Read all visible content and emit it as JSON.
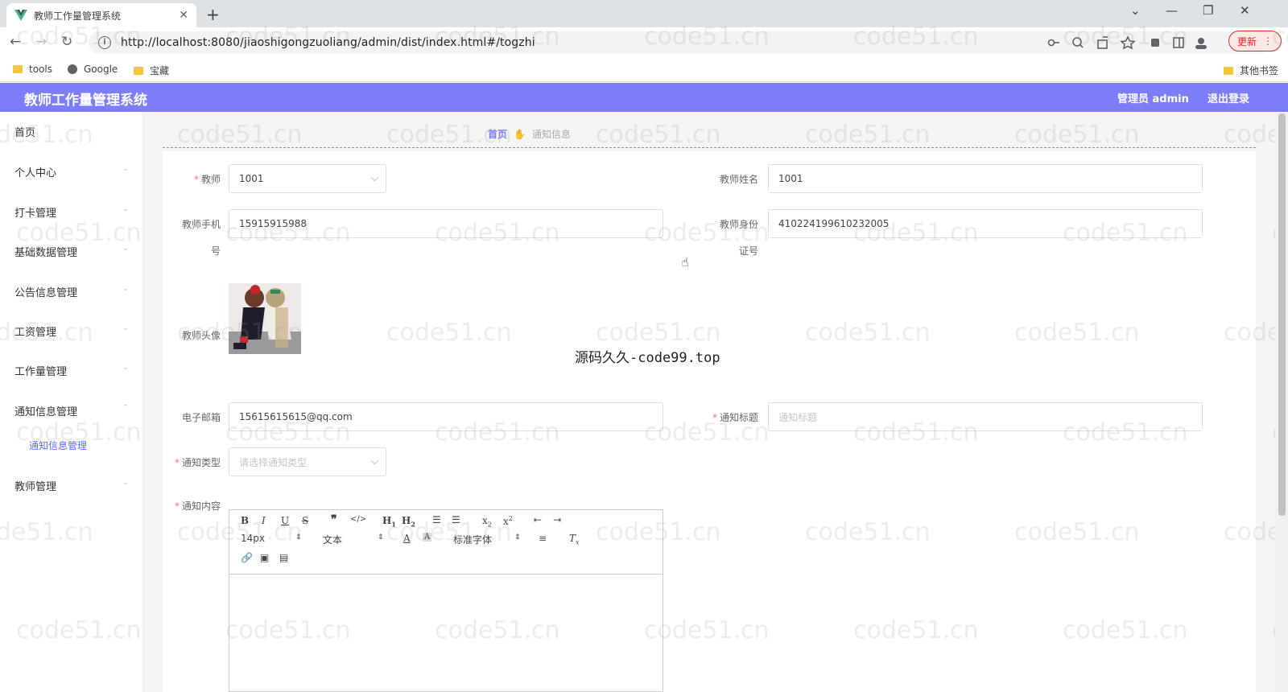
{
  "browser": {
    "tab_title": "教师工作量管理系统",
    "tab_close": "✕",
    "new_tab": "+",
    "url": "http://localhost:8080/jiaoshigongzuoliang/admin/dist/index.html#/togzhi",
    "update_label": "更新",
    "window_controls": [
      "⌄",
      "—",
      "❐",
      "✕"
    ],
    "bookmarks": [
      "tools",
      "Google",
      "宝藏"
    ],
    "other_bookmarks": "其他书签"
  },
  "header": {
    "title": "教师工作量管理系统",
    "user": "管理员 admin",
    "logout": "退出登录"
  },
  "sidebar": {
    "items": [
      {
        "label": "首页"
      },
      {
        "label": "个人中心"
      },
      {
        "label": "打卡管理"
      },
      {
        "label": "基础数据管理"
      },
      {
        "label": "公告信息管理"
      },
      {
        "label": "工资管理"
      },
      {
        "label": "工作量管理"
      },
      {
        "label": "通知信息管理"
      },
      {
        "label": "教师管理"
      }
    ],
    "sub_item": "通知信息管理"
  },
  "breadcrumb": {
    "home": "首页",
    "current": "通知信息"
  },
  "form": {
    "teacher_label": "教师",
    "teacher_value": "1001",
    "teacher_name_label": "教师姓名",
    "teacher_name_value": "1001",
    "phone_label_1": "教师手机",
    "phone_label_2": "号",
    "phone_value": "15915915988",
    "idcard_label_1": "教师身份",
    "idcard_label_2": "证号",
    "idcard_value": "410224199610232005",
    "avatar_label": "教师头像",
    "email_label": "电子邮箱",
    "email_value": "15615615615@qq.com",
    "notice_title_label": "通知标题",
    "notice_title_placeholder": "通知标题",
    "notice_type_label": "通知类型",
    "notice_type_placeholder": "请选择通知类型",
    "notice_content_label": "通知内容"
  },
  "editor": {
    "font_size": "14px",
    "block_type": "文本",
    "font_family": "标准字体"
  },
  "watermark_text": "code51.cn",
  "center_text": "源码久久-code99.top",
  "colors": {
    "header_bg": "#7d7cf9",
    "required": "#f56c6c",
    "submenu": "#5b6ef5"
  }
}
